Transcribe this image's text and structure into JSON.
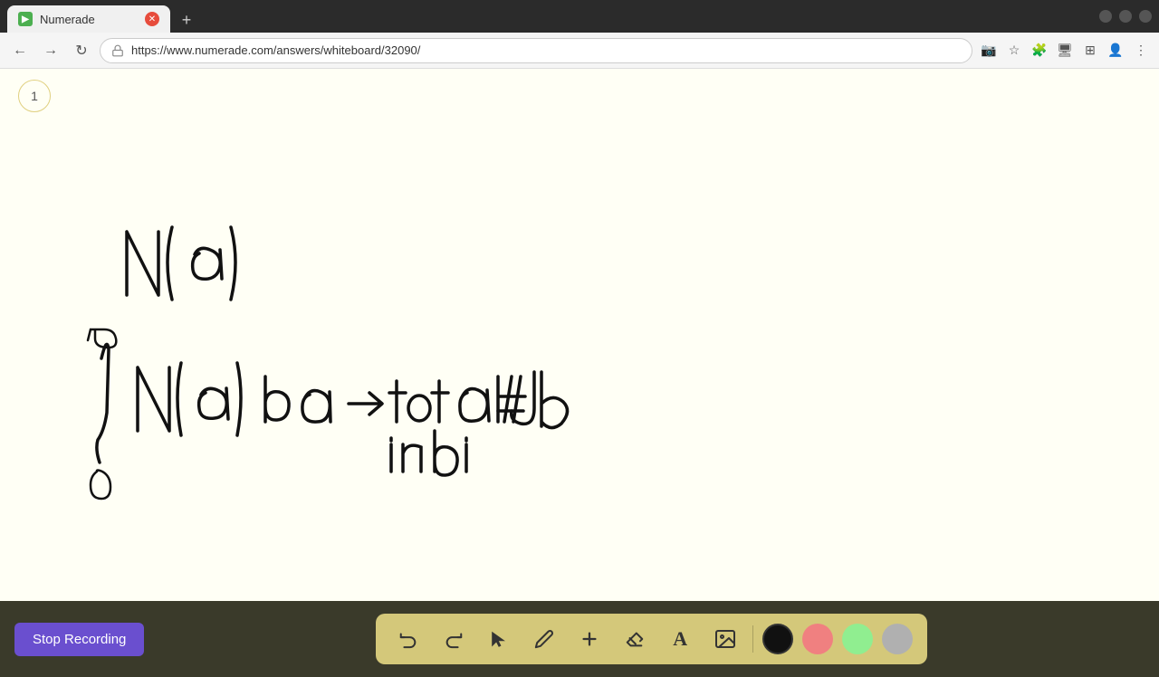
{
  "browser": {
    "tab_title": "Numerade",
    "url": "https://www.numerade.com/answers/whiteboard/32090/",
    "new_tab_icon": "+",
    "nav": {
      "back": "←",
      "forward": "→",
      "reload": "↻",
      "home": "🏠"
    }
  },
  "page_indicator": {
    "number": "1"
  },
  "toolbar": {
    "stop_recording_label": "Stop Recording",
    "tools": [
      {
        "name": "undo",
        "icon": "↩",
        "label": "Undo"
      },
      {
        "name": "redo",
        "icon": "↪",
        "label": "Redo"
      },
      {
        "name": "select",
        "icon": "▲",
        "label": "Select"
      },
      {
        "name": "pen",
        "icon": "✏",
        "label": "Pen"
      },
      {
        "name": "add",
        "icon": "+",
        "label": "Add"
      },
      {
        "name": "eraser",
        "icon": "◻",
        "label": "Eraser"
      },
      {
        "name": "text",
        "icon": "A",
        "label": "Text"
      },
      {
        "name": "image",
        "icon": "🖼",
        "label": "Image"
      }
    ],
    "colors": [
      {
        "name": "black",
        "value": "#111111"
      },
      {
        "name": "pink",
        "value": "#f08080"
      },
      {
        "name": "green",
        "value": "#90ee90"
      },
      {
        "name": "gray",
        "value": "#b0b0b0"
      }
    ]
  },
  "colors": {
    "accent_purple": "#6a4fcf",
    "toolbar_bg": "#d4c87a",
    "bottom_bar": "#3a3a2a",
    "whiteboard_bg": "#fffff5"
  }
}
